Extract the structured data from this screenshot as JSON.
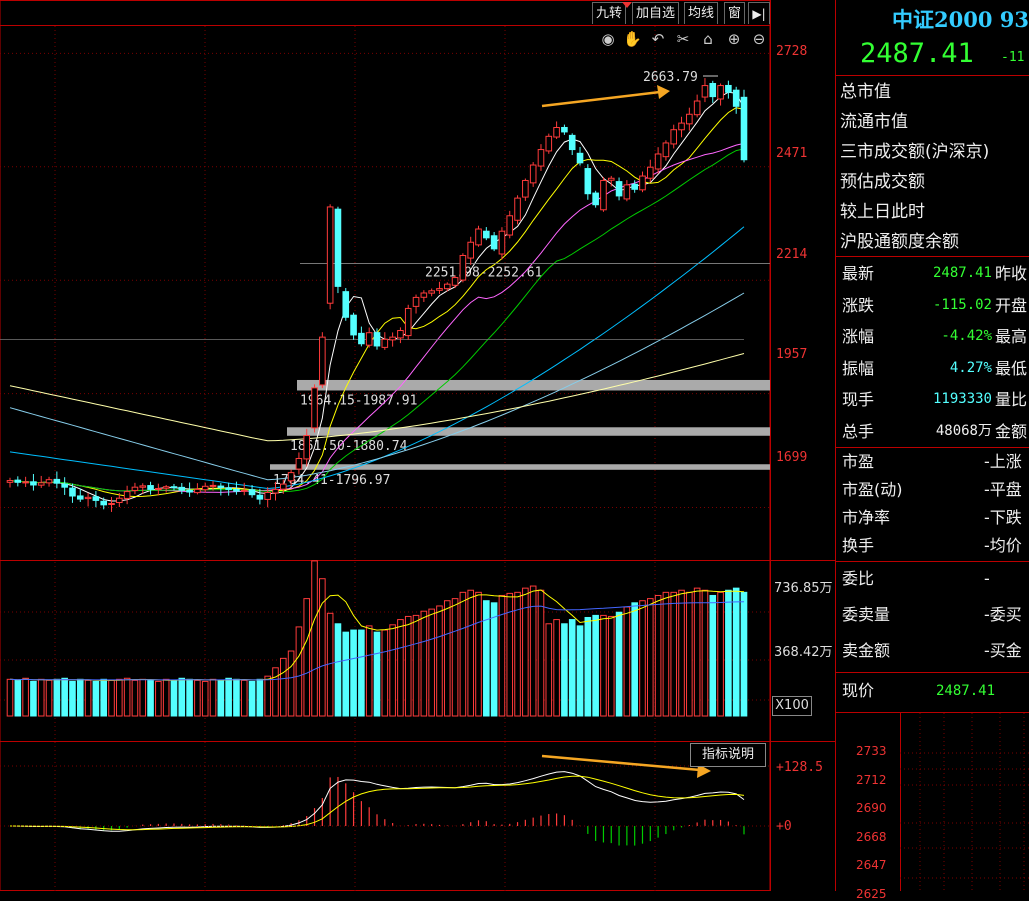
{
  "toolbar": {
    "buttons": [
      "九转",
      "加自选",
      "均线",
      "窗"
    ],
    "expand_icon": "arrow-right-bar-icon",
    "tools": [
      "eye-icon",
      "hand-icon",
      "undo-icon",
      "scissors-icon",
      "lock-icon",
      "zoom-in-icon",
      "zoom-out-icon"
    ]
  },
  "colors": {
    "up": "#ff3b3b",
    "down": "#54ffff",
    "ma5": "#ffffff",
    "ma10": "#ffff00",
    "ma20": "#ff66ff",
    "ma30": "#00cc00",
    "ma60": "#00bfff",
    "ma120": "#87ceeb",
    "ma250": "#ffffaa",
    "arrow": "#f5a623"
  },
  "chart_data": [
    {
      "type": "candlestick",
      "title": "中证2000",
      "y_ticks": [
        "2728",
        "2471",
        "2214",
        "1957",
        "1699"
      ],
      "ylim": [
        1580,
        2790
      ],
      "annotations": {
        "high_label": "2663.79",
        "gaps": [
          "2251.98-2252.61",
          "1964.15-1987.91",
          "1861.50-1880.74",
          "1784.41-1796.97"
        ]
      },
      "closes": [
        1760,
        1756,
        1757,
        1750,
        1755,
        1762,
        1754,
        1745,
        1725,
        1718,
        1722,
        1715,
        1705,
        1708,
        1720,
        1735,
        1745,
        1748,
        1740,
        1742,
        1746,
        1744,
        1738,
        1734,
        1740,
        1747,
        1749,
        1744,
        1740,
        1736,
        1738,
        1728,
        1718,
        1733,
        1740,
        1752,
        1778,
        1810,
        1862,
        1970,
        2085,
        2380,
        2200,
        2130,
        2090,
        2070,
        2095,
        2065,
        2080,
        2085,
        2100,
        2150,
        2175,
        2185,
        2190,
        2195,
        2205,
        2220,
        2270,
        2300,
        2330,
        2310,
        2285,
        2325,
        2360,
        2400,
        2440,
        2475,
        2510,
        2540,
        2560,
        2550,
        2510,
        2480,
        2410,
        2385,
        2440,
        2445,
        2405,
        2430,
        2420,
        2450,
        2470,
        2500,
        2525,
        2555,
        2570,
        2590,
        2620,
        2655,
        2630,
        2655,
        2640,
        2608,
        2487
      ]
    },
    {
      "type": "bar",
      "title": "volume",
      "y_ticks": [
        "736.85万",
        "368.42万"
      ],
      "unit_label": "X100",
      "values": [
        35,
        34,
        36,
        33,
        35,
        34,
        35,
        36,
        33,
        35,
        34,
        33,
        35,
        34,
        35,
        36,
        34,
        35,
        34,
        33,
        35,
        34,
        36,
        35,
        34,
        33,
        35,
        34,
        36,
        35,
        34,
        33,
        35,
        38,
        46,
        55,
        62,
        85,
        112,
        148,
        131,
        98,
        88,
        80,
        82,
        82,
        86,
        80,
        82,
        87,
        92,
        95,
        96,
        100,
        102,
        105,
        110,
        112,
        118,
        120,
        118,
        110,
        108,
        115,
        117,
        118,
        122,
        124,
        120,
        88,
        92,
        88,
        92,
        86,
        94,
        96,
        96,
        95,
        99,
        104,
        108,
        110,
        112,
        115,
        118,
        118,
        120,
        118,
        122,
        120,
        115,
        118,
        120,
        122,
        118
      ]
    },
    {
      "type": "line",
      "title": "macd",
      "buttons": [
        "指标说明"
      ],
      "y_ticks": [
        "+128.5",
        "+0"
      ]
    }
  ],
  "quote": {
    "name": "中证2000 93",
    "price": "2487.41",
    "change_partial": "-11"
  },
  "info_labels": [
    "总市值",
    "流通市值",
    "三市成交额(沪深京)",
    "预估成交额",
    "较上日此时",
    "沪股通额度余额"
  ],
  "stats": [
    {
      "label": "最新",
      "value": "2487.41",
      "side": "昨收",
      "color": "#33ff33"
    },
    {
      "label": "涨跌",
      "value": "-115.02",
      "side": "开盘",
      "color": "#33ff33"
    },
    {
      "label": "涨幅",
      "value": "-4.42%",
      "side": "最高",
      "color": "#33ff33"
    },
    {
      "label": "振幅",
      "value": "4.27%",
      "side": "最低",
      "color": "#54ffff"
    },
    {
      "label": "现手",
      "value": "1193330",
      "side": "量比",
      "color": "#54ffff"
    },
    {
      "label": "总手",
      "value": "48068万",
      "side": "金额",
      "color": "#eeeeee"
    }
  ],
  "market": [
    {
      "label": "市盈",
      "side": "-上涨"
    },
    {
      "label": "市盈(动)",
      "side": "-平盘"
    },
    {
      "label": "市净率",
      "side": "-下跌"
    },
    {
      "label": "换手",
      "side": "-均价"
    }
  ],
  "orders": [
    {
      "label": "委比",
      "side": "-"
    },
    {
      "label": "委卖量",
      "side": "-委买"
    },
    {
      "label": "卖金额",
      "side": "-买金"
    }
  ],
  "current": {
    "label": "现价",
    "value": "2487.41"
  },
  "mini_ticks": [
    "2733",
    "2712",
    "2690",
    "2668",
    "2647",
    "2625"
  ]
}
